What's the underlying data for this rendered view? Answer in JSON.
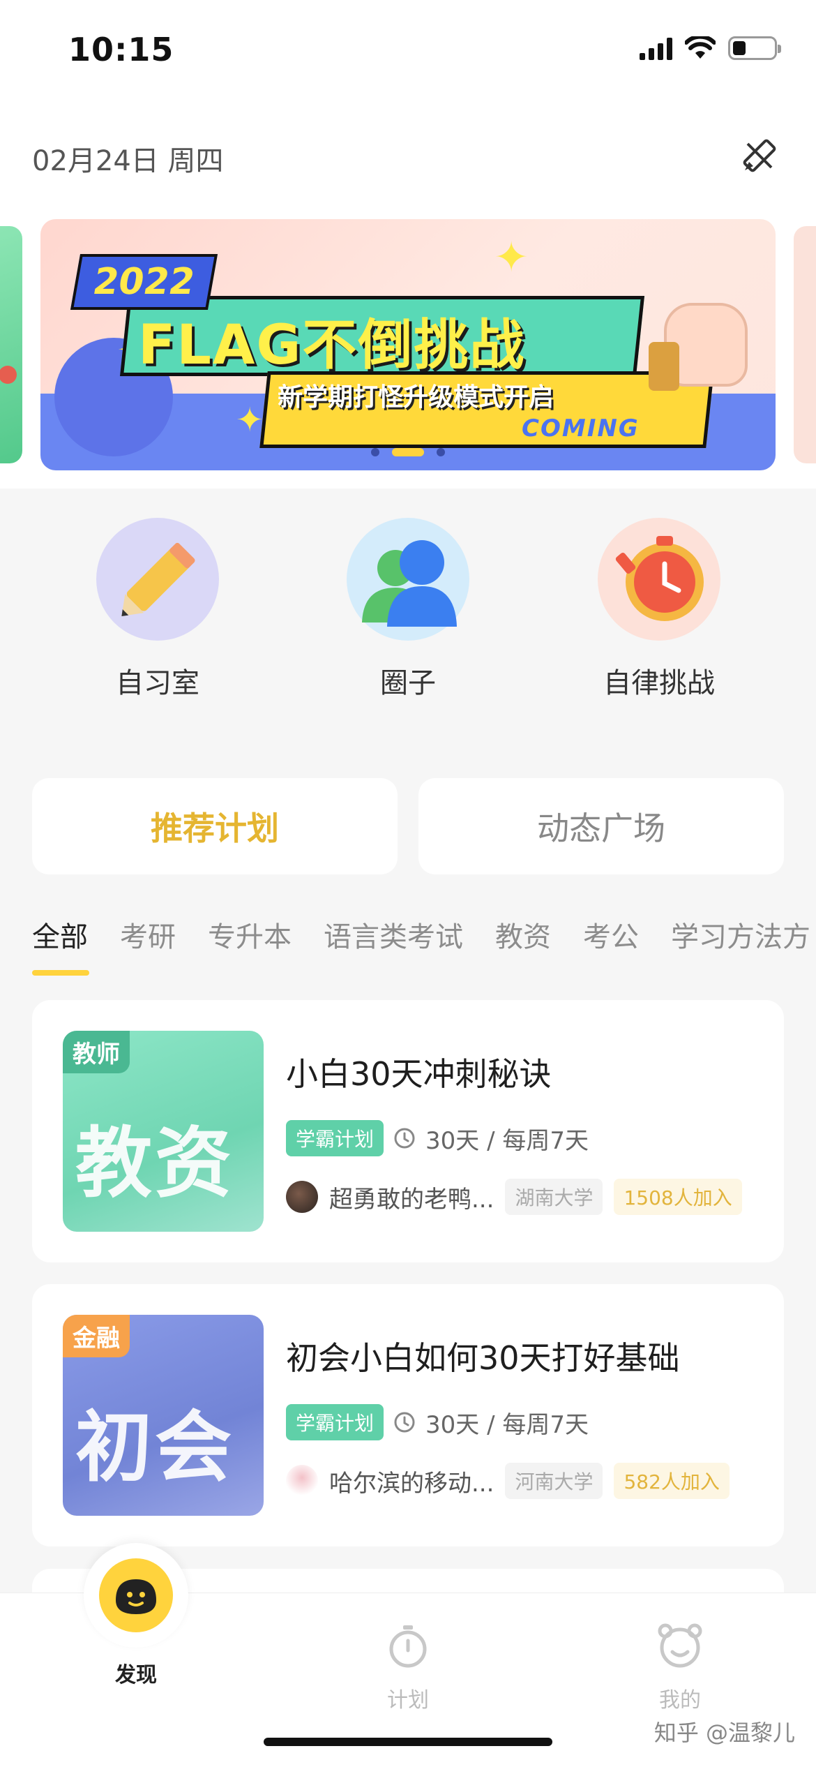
{
  "status_bar": {
    "time": "10:15"
  },
  "header": {
    "date": "02月24日 周四"
  },
  "banner": {
    "year": "2022",
    "title": "FLAG不倒挑战",
    "subtitle": "新学期打怪升级模式开启",
    "coming": "COMING",
    "active_slide_index": 2,
    "slide_count": 3
  },
  "features": [
    {
      "label": "自习室",
      "icon": "pencil-icon"
    },
    {
      "label": "圈子",
      "icon": "people-icon"
    },
    {
      "label": "自律挑战",
      "icon": "timer-icon"
    }
  ],
  "plan_tabs": [
    {
      "label": "推荐计划",
      "active": true
    },
    {
      "label": "动态广场",
      "active": false
    }
  ],
  "categories": [
    "全部",
    "考研",
    "专升本",
    "语言类考试",
    "教资",
    "考公",
    "学习方法方"
  ],
  "plans": [
    {
      "cover_tag": "教师",
      "cover_text": "教资",
      "title": "小白30天冲刺秘诀",
      "badge": "学霸计划",
      "duration": "30天 / 每周7天",
      "author": "超勇敢的老鸭...",
      "school": "湖南大学",
      "joined": "1508人加入"
    },
    {
      "cover_tag": "金融",
      "cover_text": "初会",
      "title": "初会小白如何30天打好基础",
      "badge": "学霸计划",
      "duration": "30天 / 每周7天",
      "author": "哈尔滨的移动...",
      "school": "河南大学",
      "joined": "582人加入"
    }
  ],
  "bottom_nav": [
    {
      "label": "发现",
      "active": true
    },
    {
      "label": "计划",
      "active": false
    },
    {
      "label": "我的",
      "active": false
    }
  ],
  "watermark": "知乎 @温黎儿",
  "colors": {
    "accent": "#ffd33d",
    "active_tab_text": "#e5b531",
    "badge_green": "#5fd0a8",
    "join_text": "#e2b43c"
  }
}
